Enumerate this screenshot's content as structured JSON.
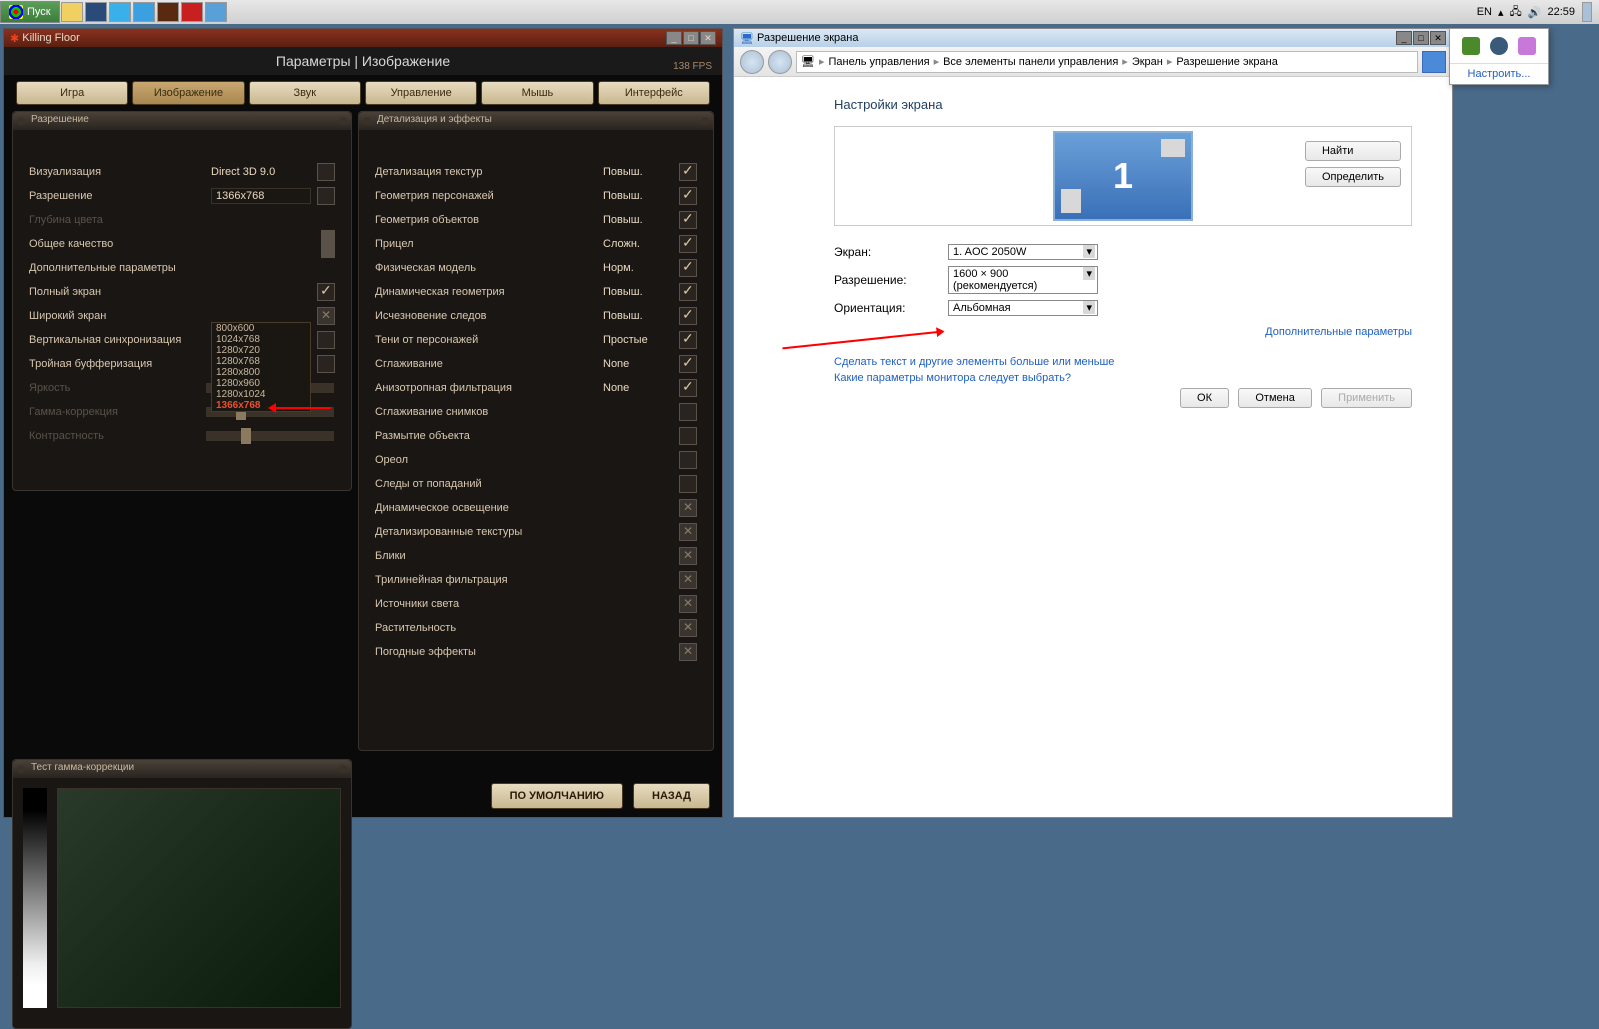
{
  "taskbar": {
    "start": "Пуск",
    "lang": "EN",
    "clock": "22:59"
  },
  "game": {
    "title": "Killing Floor",
    "header": "Параметры | Изображение",
    "fps": "138 FPS",
    "tabs": [
      "Игра",
      "Изображение",
      "Звук",
      "Управление",
      "Мышь",
      "Интерфейс"
    ],
    "active_tab": 1,
    "panel_res": "Разрешение",
    "panel_det": "Детализация и эффекты",
    "panel_gamma": "Тест гамма-коррекции",
    "left": {
      "vis_l": "Визуализация",
      "vis_v": "Direct 3D 9.0",
      "res_l": "Разрешение",
      "res_v": "1366x768",
      "depth_l": "Глубина цвета",
      "qual_l": "Общее качество",
      "adv_l": "Дополнительные параметры",
      "full_l": "Полный экран",
      "wide_l": "Широкий экран",
      "vsync_l": "Вертикальная синхронизация",
      "triple_l": "Тройная буфферизация",
      "bright_l": "Яркость",
      "gamma_l": "Гамма-коррекция",
      "contr_l": "Контрастность"
    },
    "dropdown": [
      "800x600",
      "1024x768",
      "1280x720",
      "1280x768",
      "1280x800",
      "1280x960",
      "1280x1024",
      "1366x768"
    ],
    "right": [
      {
        "l": "Детализация текстур",
        "v": "Повыш.",
        "c": "on"
      },
      {
        "l": "Геометрия персонажей",
        "v": "Повыш.",
        "c": "on"
      },
      {
        "l": "Геометрия объектов",
        "v": "Повыш.",
        "c": "on"
      },
      {
        "l": "Прицел",
        "v": "Сложн.",
        "c": "on"
      },
      {
        "l": "Физическая модель",
        "v": "Норм.",
        "c": "on"
      },
      {
        "l": "Динамическая геометрия",
        "v": "Повыш.",
        "c": "on"
      },
      {
        "l": "Исчезновение следов",
        "v": "Повыш.",
        "c": "on"
      },
      {
        "l": "Тени от персонажей",
        "v": "Простые",
        "c": "on"
      },
      {
        "l": "Сглаживание",
        "v": "None",
        "c": "on"
      },
      {
        "l": "Анизотропная фильтрация",
        "v": "None",
        "c": "on"
      },
      {
        "l": "Сглаживание снимков",
        "v": "",
        "c": "off"
      },
      {
        "l": "Размытие объекта",
        "v": "",
        "c": "off"
      },
      {
        "l": "Ореол",
        "v": "",
        "c": "off"
      },
      {
        "l": "Следы от попаданий",
        "v": "",
        "c": "off"
      },
      {
        "l": "Динамическое освещение",
        "v": "",
        "c": "dis"
      },
      {
        "l": "Детализированные текстуры",
        "v": "",
        "c": "dis"
      },
      {
        "l": "Блики",
        "v": "",
        "c": "dis"
      },
      {
        "l": "Трилинейная фильтрация",
        "v": "",
        "c": "dis"
      },
      {
        "l": "Источники света",
        "v": "",
        "c": "dis"
      },
      {
        "l": "Растительность",
        "v": "",
        "c": "dis"
      },
      {
        "l": "Погодные эффекты",
        "v": "",
        "c": "dis"
      }
    ],
    "btn_default": "ПО УМОЛЧАНИЮ",
    "btn_back": "НАЗАД"
  },
  "cp": {
    "title": "Разрешение экрана",
    "crumbs": [
      "Панель управления",
      "Все элементы панели управления",
      "Экран",
      "Разрешение экрана"
    ],
    "h": "Настройки экрана",
    "mon_num": "1",
    "btn_find": "Найти",
    "btn_detect": "Определить",
    "screen_l": "Экран:",
    "screen_v": "1. AOC 2050W",
    "res_l": "Разрешение:",
    "res_v": "1600 × 900 (рекомендуется)",
    "orient_l": "Ориентация:",
    "orient_v": "Альбомная",
    "adv": "Дополнительные параметры",
    "link1": "Сделать текст и другие элементы больше или меньше",
    "link2": "Какие параметры монитора следует выбрать?",
    "btn_ok": "ОК",
    "btn_cancel": "Отмена",
    "btn_apply": "Применить"
  },
  "tray_popup": {
    "link": "Настроить..."
  }
}
